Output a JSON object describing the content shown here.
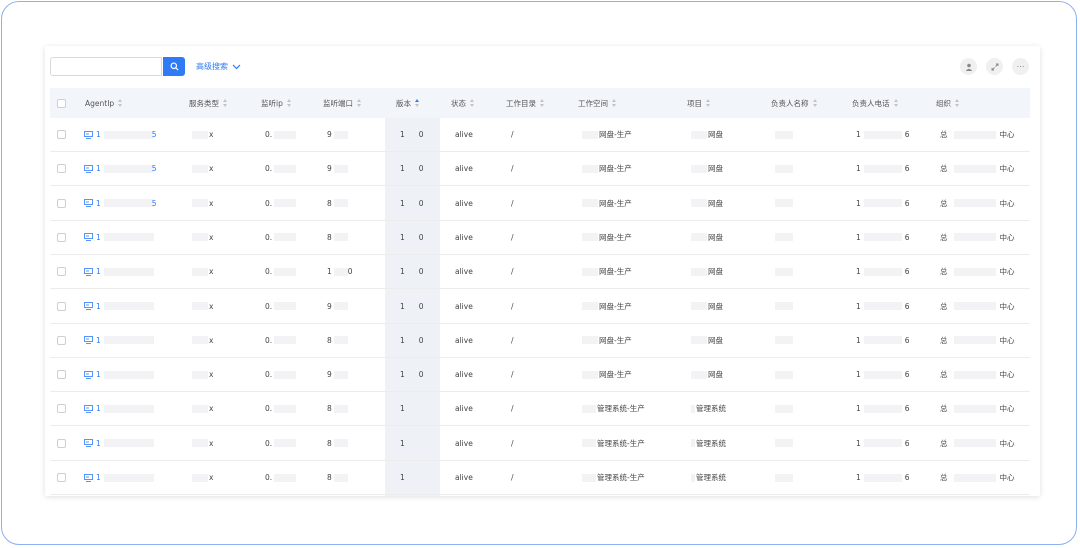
{
  "toolbar": {
    "search_placeholder": "",
    "advanced_search_label": "高级搜索"
  },
  "columns": [
    {
      "key": "agentip",
      "label": "AgentIp"
    },
    {
      "key": "service_type",
      "label": "服务类型"
    },
    {
      "key": "listen_ip",
      "label": "监听ip"
    },
    {
      "key": "listen_port",
      "label": "监听端口"
    },
    {
      "key": "version",
      "label": "版本"
    },
    {
      "key": "status",
      "label": "状态"
    },
    {
      "key": "work_dir",
      "label": "工作目录"
    },
    {
      "key": "workspace",
      "label": "工作空间"
    },
    {
      "key": "project",
      "label": "项目"
    },
    {
      "key": "owner_name",
      "label": "负责人名称"
    },
    {
      "key": "owner_phone",
      "label": "负责人电话"
    },
    {
      "key": "org",
      "label": "组织"
    }
  ],
  "rows": [
    {
      "agent_start": "1",
      "agent_end": "5",
      "service": "x",
      "ip": "0.",
      "port_a": "9",
      "port_b": "",
      "ver_a": "1",
      "ver_b": "0",
      "status": "alive",
      "dir": "/",
      "workspace": "网盘-生产",
      "project": "网盘",
      "phone_a": "1",
      "phone_b": "6",
      "org_a": "总",
      "org_b": "中心"
    },
    {
      "agent_start": "1",
      "agent_end": "5",
      "service": "x",
      "ip": "0.",
      "port_a": "9",
      "port_b": "",
      "ver_a": "1",
      "ver_b": "0",
      "status": "alive",
      "dir": "/",
      "workspace": "网盘-生产",
      "project": "网盘",
      "phone_a": "1",
      "phone_b": "6",
      "org_a": "总",
      "org_b": "中心"
    },
    {
      "agent_start": "1",
      "agent_end": "5",
      "service": "x",
      "ip": "0.",
      "port_a": "8",
      "port_b": "",
      "ver_a": "1",
      "ver_b": "0",
      "status": "alive",
      "dir": "/",
      "workspace": "网盘-生产",
      "project": "网盘",
      "phone_a": "1",
      "phone_b": "6",
      "org_a": "总",
      "org_b": "中心"
    },
    {
      "agent_start": "1",
      "agent_end": "",
      "service": "x",
      "ip": "0.",
      "port_a": "8",
      "port_b": "",
      "ver_a": "1",
      "ver_b": "0",
      "status": "alive",
      "dir": "/",
      "workspace": "网盘-生产",
      "project": "网盘",
      "phone_a": "1",
      "phone_b": "6",
      "org_a": "总",
      "org_b": "中心"
    },
    {
      "agent_start": "1",
      "agent_end": "",
      "service": "x",
      "ip": "0.",
      "port_a": "1",
      "port_b": "0",
      "ver_a": "1",
      "ver_b": "0",
      "status": "alive",
      "dir": "/",
      "workspace": "网盘-生产",
      "project": "网盘",
      "phone_a": "1",
      "phone_b": "6",
      "org_a": "总",
      "org_b": "中心"
    },
    {
      "agent_start": "1",
      "agent_end": "",
      "service": "x",
      "ip": "0.",
      "port_a": "9",
      "port_b": "",
      "ver_a": "1",
      "ver_b": "0",
      "status": "alive",
      "dir": "/",
      "workspace": "网盘-生产",
      "project": "网盘",
      "phone_a": "1",
      "phone_b": "6",
      "org_a": "总",
      "org_b": "中心"
    },
    {
      "agent_start": "1",
      "agent_end": "",
      "service": "x",
      "ip": "0.",
      "port_a": "8",
      "port_b": "",
      "ver_a": "1",
      "ver_b": "0",
      "status": "alive",
      "dir": "/",
      "workspace": "网盘-生产",
      "project": "网盘",
      "phone_a": "1",
      "phone_b": "6",
      "org_a": "总",
      "org_b": "中心"
    },
    {
      "agent_start": "1",
      "agent_end": "",
      "service": "x",
      "ip": "0.",
      "port_a": "9",
      "port_b": "",
      "ver_a": "1",
      "ver_b": "0",
      "status": "alive",
      "dir": "/",
      "workspace": "网盘-生产",
      "project": "网盘",
      "phone_a": "1",
      "phone_b": "6",
      "org_a": "总",
      "org_b": "中心"
    },
    {
      "agent_start": "1",
      "agent_end": "",
      "service": "x",
      "ip": "0.",
      "port_a": "8",
      "port_b": "",
      "ver_a": "1",
      "ver_b": "",
      "status": "alive",
      "dir": "/",
      "workspace": "管理系统-生产",
      "project": "管理系统",
      "phone_a": "1",
      "phone_b": "6",
      "org_a": "总",
      "org_b": "中心"
    },
    {
      "agent_start": "1",
      "agent_end": "",
      "service": "x",
      "ip": "0.",
      "port_a": "8",
      "port_b": "",
      "ver_a": "1",
      "ver_b": "",
      "status": "alive",
      "dir": "/",
      "workspace": "管理系统-生产",
      "project": "管理系统",
      "phone_a": "1",
      "phone_b": "6",
      "org_a": "总",
      "org_b": "中心"
    },
    {
      "agent_start": "1",
      "agent_end": "",
      "service": "x",
      "ip": "0.",
      "port_a": "8",
      "port_b": "",
      "ver_a": "1",
      "ver_b": "",
      "status": "alive",
      "dir": "/",
      "workspace": "管理系统-生产",
      "project": "管理系统",
      "phone_a": "1",
      "phone_b": "6",
      "org_a": "总",
      "org_b": "中心"
    }
  ],
  "colors": {
    "accent": "#2f7bf5",
    "header_bg": "#f2f5fa",
    "sorted_col_bg": "#eef1f6",
    "frame_border": "#8fb0f0"
  },
  "icons": {
    "search": "search-icon",
    "user": "user-icon",
    "fullscreen": "fullscreen-icon",
    "more": "more-icon",
    "chevron": "chevron-down-icon",
    "agent": "server-icon"
  }
}
